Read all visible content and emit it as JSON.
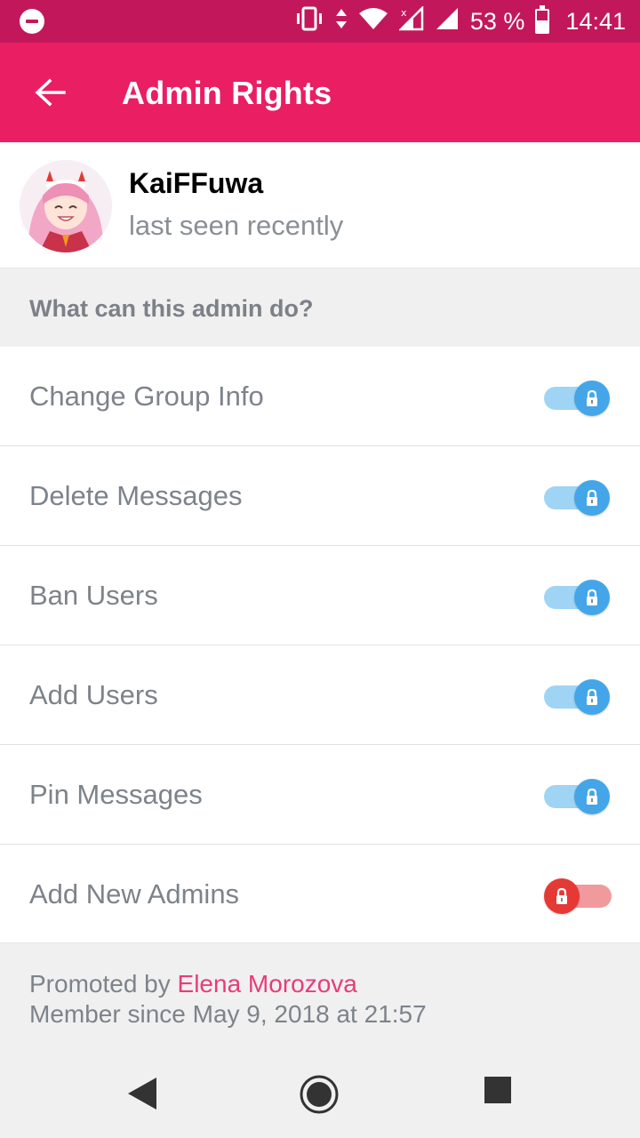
{
  "status_bar": {
    "battery_percent": "53 %",
    "battery_level": 0.53,
    "time": "14:41",
    "icons": [
      "do-not-disturb-icon",
      "vibrate-icon",
      "data-arrows-icon",
      "wifi-icon",
      "signal-x-icon",
      "signal-icon",
      "battery-icon"
    ]
  },
  "app_bar": {
    "title": "Admin Rights",
    "back_icon": "arrow-back-icon"
  },
  "profile": {
    "name": "KaiFFuwa",
    "status": "last seen recently"
  },
  "section": {
    "title": "What can this admin do?"
  },
  "rights": [
    {
      "label": "Change Group Info",
      "enabled": true,
      "locked": true
    },
    {
      "label": "Delete Messages",
      "enabled": true,
      "locked": true
    },
    {
      "label": "Ban Users",
      "enabled": true,
      "locked": true
    },
    {
      "label": "Add Users",
      "enabled": true,
      "locked": true
    },
    {
      "label": "Pin Messages",
      "enabled": true,
      "locked": true
    },
    {
      "label": "Add New Admins",
      "enabled": false,
      "locked": true
    }
  ],
  "footer": {
    "promoted_prefix": "Promoted by ",
    "promoter": "Elena Morozova",
    "member_since": "Member since May 9, 2018 at 21:57"
  },
  "colors": {
    "status_bar": "#c2185b",
    "app_bar": "#e91e63",
    "toggle_on": "#44a6e8",
    "toggle_off": "#e53935",
    "link": "#e63d7a"
  }
}
